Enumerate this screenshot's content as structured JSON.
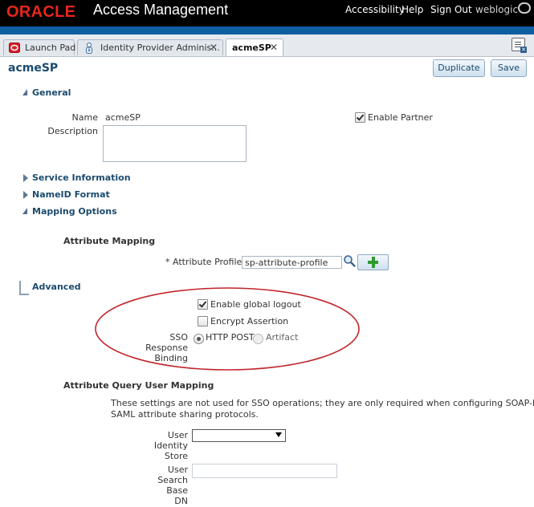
{
  "header": {
    "brand": "ORACLE",
    "product": "Access Management",
    "links": {
      "accessibility": "Accessibility",
      "help": "Help",
      "sign_out": "Sign Out"
    },
    "user": "weblogic"
  },
  "tabs": [
    {
      "label": "Launch Pad",
      "close": ""
    },
    {
      "label": "Identity Provider Adminis...",
      "close": "✕"
    },
    {
      "label": "acmeSP",
      "close": "✕"
    }
  ],
  "page": {
    "title": "acmeSP",
    "buttons": {
      "duplicate": "Duplicate",
      "save": "Save"
    }
  },
  "general": {
    "header": "General",
    "name_label": "Name",
    "name_value": "acmeSP",
    "description_label": "Description",
    "description_value": "",
    "enable_partner_label": "Enable Partner",
    "enable_partner_checked": true
  },
  "sections": {
    "service_information": "Service Information",
    "nameid_format": "NameID Format",
    "mapping_options": "Mapping Options",
    "advanced": "Advanced"
  },
  "attribute_mapping": {
    "header": "Attribute Mapping",
    "required_marker": "*",
    "profile_label": "Attribute Profile",
    "profile_value": "sp-attribute-profile"
  },
  "advanced": {
    "enable_global_logout_label": "Enable global logout",
    "enable_global_logout_checked": true,
    "encrypt_assertion_label": "Encrypt Assertion",
    "encrypt_assertion_checked": false,
    "sso_binding_label": [
      "SSO",
      "Response",
      "Binding"
    ],
    "sso_binding_options": {
      "http_post": "HTTP POST",
      "artifact": "Artifact"
    },
    "sso_binding_selected": "HTTP POST",
    "highlight_color": "#c0262c"
  },
  "attribute_query": {
    "header": "Attribute Query User Mapping",
    "note_line1": "These settings are not used for SSO operations; they are only required when configuring SOAP-based",
    "note_line2": "SAML attribute sharing protocols.",
    "user_identity_store_label": [
      "User",
      "Identity",
      "Store"
    ],
    "user_identity_store_value": "",
    "user_search_base_label": [
      "User",
      "Search",
      "Base",
      "DN"
    ],
    "user_search_base_value": ""
  },
  "colors": {
    "header_bg": "#000000",
    "brand": "#e8261b",
    "accent_band": "#0f5ea2",
    "section_text": "#1b4b6e"
  }
}
